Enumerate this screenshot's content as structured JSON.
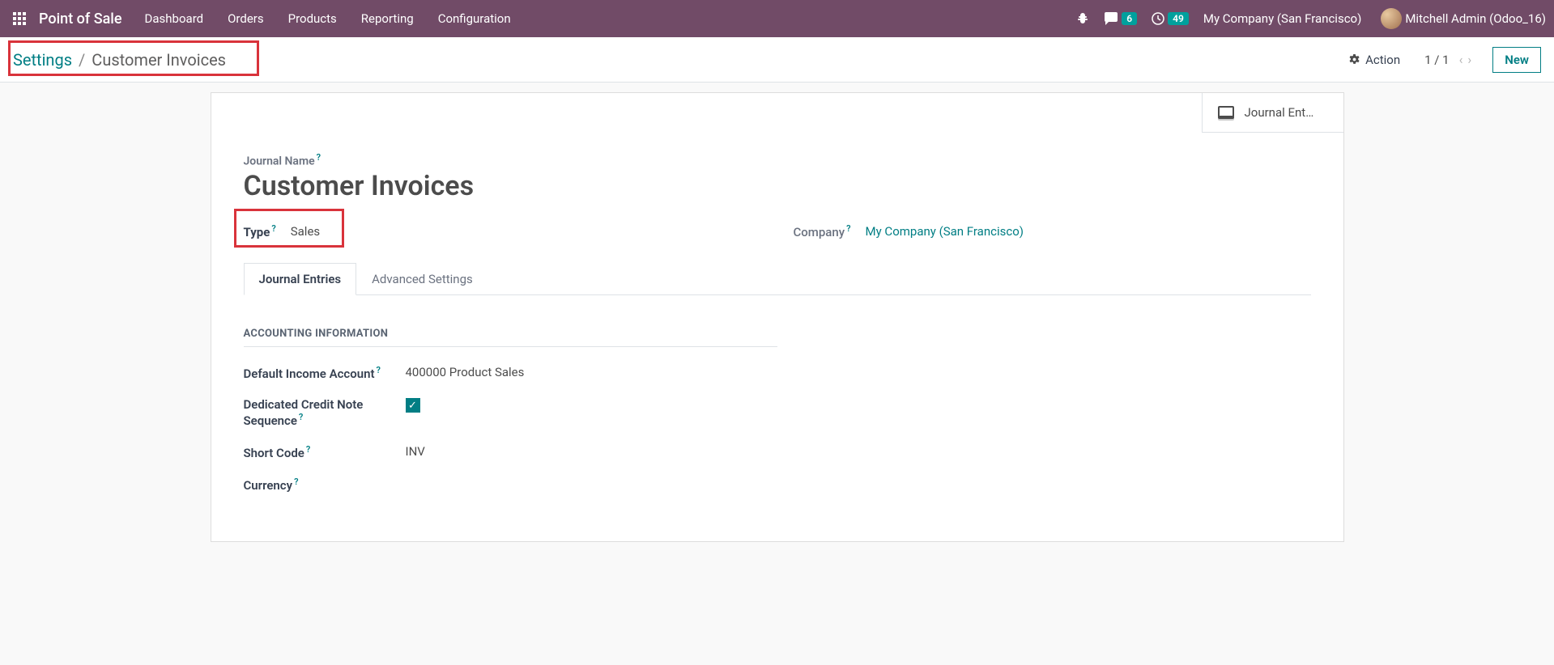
{
  "navbar": {
    "brand": "Point of Sale",
    "menu": [
      "Dashboard",
      "Orders",
      "Products",
      "Reporting",
      "Configuration"
    ],
    "messaging_count": "6",
    "activities_count": "49",
    "company": "My Company (San Francisco)",
    "user": "Mitchell Admin (Odoo_16)"
  },
  "breadcrumb": {
    "parent": "Settings",
    "current": "Customer Invoices"
  },
  "control": {
    "action_label": "Action",
    "pager": "1 / 1",
    "new_label": "New"
  },
  "stat_button": {
    "label": "Journal Ent…"
  },
  "form": {
    "journal_name_label": "Journal Name",
    "journal_name": "Customer Invoices",
    "type_label": "Type",
    "type_value": "Sales",
    "company_label": "Company",
    "company_value": "My Company (San Francisco)"
  },
  "tabs": [
    "Journal Entries",
    "Advanced Settings"
  ],
  "accounting": {
    "section_title": "ACCOUNTING INFORMATION",
    "default_income_label": "Default Income Account",
    "default_income_value": "400000 Product Sales",
    "dedicated_credit_label": "Dedicated Credit Note Sequence",
    "dedicated_credit_checked": true,
    "short_code_label": "Short Code",
    "short_code_value": "INV",
    "currency_label": "Currency"
  }
}
